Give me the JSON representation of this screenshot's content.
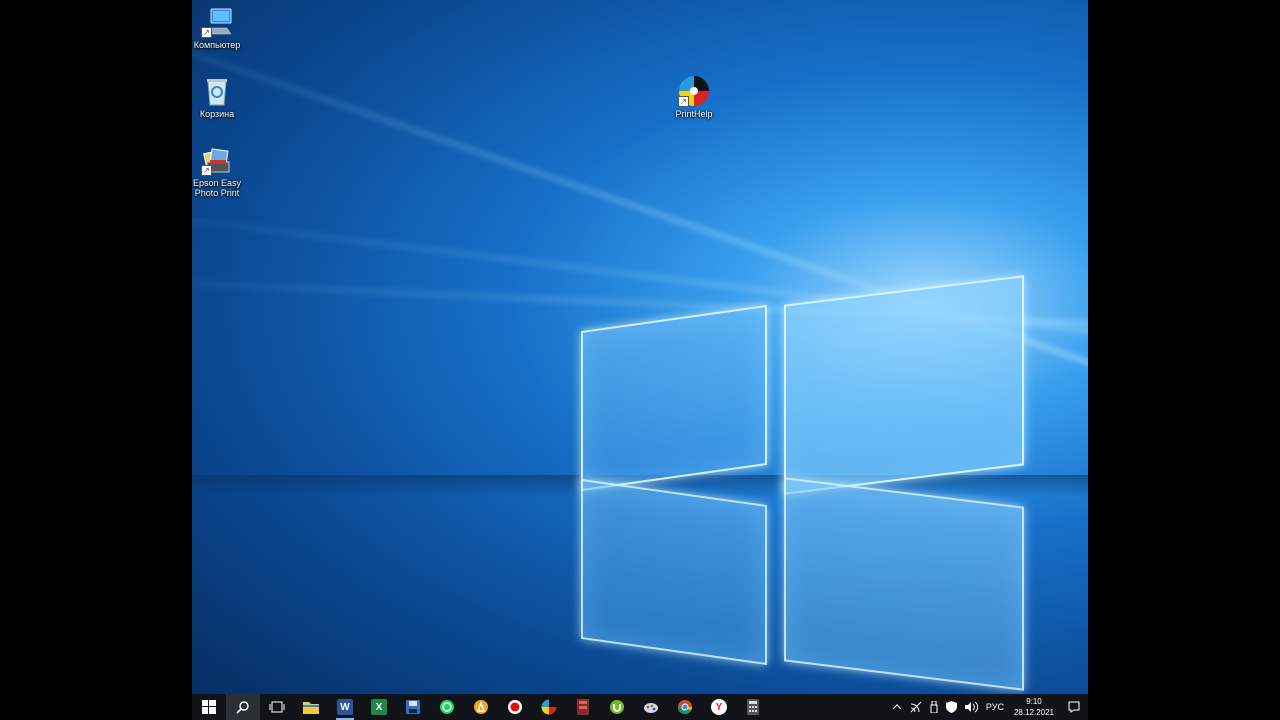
{
  "desktop": {
    "icons": [
      {
        "label": "Компьютер",
        "icon": "computer-icon"
      },
      {
        "label": "Корзина",
        "icon": "recycle-bin-icon"
      },
      {
        "label": "Epson Easy Photo Print",
        "icon": "epson-photo-print-icon"
      },
      {
        "label": "PrintHelp",
        "icon": "printhelp-icon"
      }
    ]
  },
  "taskbar": {
    "apps": [
      {
        "name": "start",
        "icon": "windows-logo-icon"
      },
      {
        "name": "search",
        "icon": "search-icon"
      },
      {
        "name": "task-view",
        "icon": "task-view-icon"
      },
      {
        "name": "file-explorer",
        "icon": "folder-icon"
      },
      {
        "name": "word",
        "icon": "word-icon",
        "glyph": "W"
      },
      {
        "name": "excel-like",
        "icon": "spreadsheet-icon",
        "glyph": "X"
      },
      {
        "name": "save",
        "icon": "floppy-disk-icon"
      },
      {
        "name": "whatsapp",
        "icon": "whatsapp-icon"
      },
      {
        "name": "avast",
        "icon": "avast-icon"
      },
      {
        "name": "recorder",
        "icon": "record-icon"
      },
      {
        "name": "printhelp",
        "icon": "printhelp-icon"
      },
      {
        "name": "archive",
        "icon": "archive-icon"
      },
      {
        "name": "utorrent",
        "icon": "utorrent-icon"
      },
      {
        "name": "paint-tool",
        "icon": "paint-icon"
      },
      {
        "name": "chrome",
        "icon": "chrome-icon"
      },
      {
        "name": "yandex",
        "icon": "yandex-browser-icon",
        "glyph": "Y"
      },
      {
        "name": "calculator",
        "icon": "calculator-icon"
      }
    ],
    "tray": {
      "language": "РУС",
      "time": "9:10",
      "date": "28.12.2021"
    }
  },
  "colors": {
    "taskbar_bg": "#101418",
    "accent": "#0a64c8"
  }
}
